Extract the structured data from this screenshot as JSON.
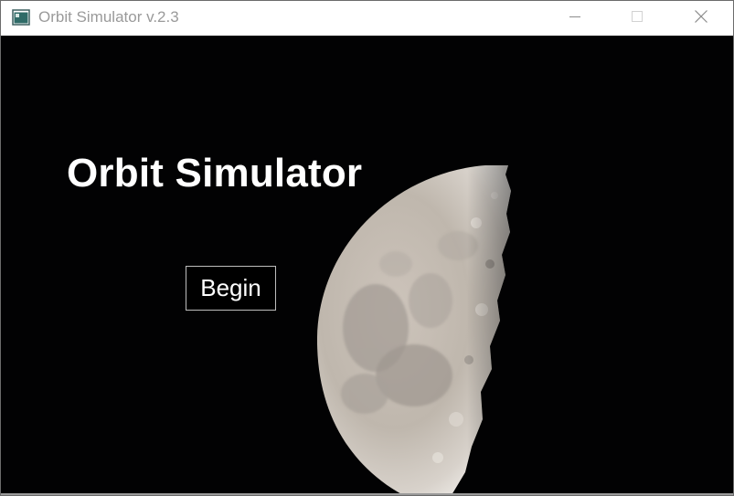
{
  "window": {
    "title": "Orbit Simulator v.2.3",
    "icon": "app-window-icon",
    "controls": [
      "minimize-icon",
      "maximize-icon",
      "close-icon"
    ]
  },
  "main": {
    "heading": "Orbit Simulator",
    "begin_label": "Begin",
    "background": "half-moon-photo"
  },
  "colors": {
    "titlebar_bg": "#ffffff",
    "title_text": "#9a9a9a",
    "content_bg": "#020203",
    "heading_text": "#ffffff",
    "button_border": "#bdbdbd"
  }
}
